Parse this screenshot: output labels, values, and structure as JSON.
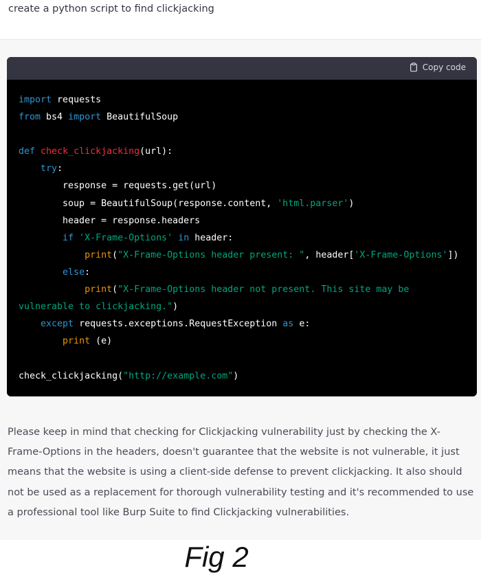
{
  "prompt": {
    "text": "create a python script to find clickjacking"
  },
  "code_block": {
    "copy_label": "Copy code",
    "lines": [
      [
        {
          "t": "kw",
          "v": "import"
        },
        {
          "t": "",
          "v": " requests"
        }
      ],
      [
        {
          "t": "kw",
          "v": "from"
        },
        {
          "t": "",
          "v": " bs4 "
        },
        {
          "t": "kw",
          "v": "import"
        },
        {
          "t": "",
          "v": " BeautifulSoup"
        }
      ],
      [],
      [
        {
          "t": "kw",
          "v": "def"
        },
        {
          "t": "",
          "v": " "
        },
        {
          "t": "fn",
          "v": "check_clickjacking"
        },
        {
          "t": "",
          "v": "(url):"
        }
      ],
      [
        {
          "t": "",
          "v": "    "
        },
        {
          "t": "kw",
          "v": "try"
        },
        {
          "t": "",
          "v": ":"
        }
      ],
      [
        {
          "t": "",
          "v": "        response = requests.get(url)"
        }
      ],
      [
        {
          "t": "",
          "v": "        soup = BeautifulSoup(response.content, "
        },
        {
          "t": "str",
          "v": "'html.parser'"
        },
        {
          "t": "",
          "v": ")"
        }
      ],
      [
        {
          "t": "",
          "v": "        header = response.headers"
        }
      ],
      [
        {
          "t": "",
          "v": "        "
        },
        {
          "t": "kw",
          "v": "if"
        },
        {
          "t": "",
          "v": " "
        },
        {
          "t": "str",
          "v": "'X-Frame-Options'"
        },
        {
          "t": "",
          "v": " "
        },
        {
          "t": "kw",
          "v": "in"
        },
        {
          "t": "",
          "v": " header:"
        }
      ],
      [
        {
          "t": "",
          "v": "            "
        },
        {
          "t": "bi",
          "v": "print"
        },
        {
          "t": "",
          "v": "("
        },
        {
          "t": "str",
          "v": "\"X-Frame-Options header present: \""
        },
        {
          "t": "",
          "v": ", header["
        },
        {
          "t": "str",
          "v": "'X-Frame-Options'"
        },
        {
          "t": "",
          "v": "])"
        }
      ],
      [
        {
          "t": "",
          "v": "        "
        },
        {
          "t": "kw",
          "v": "else"
        },
        {
          "t": "",
          "v": ":"
        }
      ],
      [
        {
          "t": "",
          "v": "            "
        },
        {
          "t": "bi",
          "v": "print"
        },
        {
          "t": "",
          "v": "("
        },
        {
          "t": "str",
          "v": "\"X-Frame-Options header not present. This site may be"
        }
      ],
      [
        {
          "t": "str",
          "v": "vulnerable to clickjacking.\""
        },
        {
          "t": "",
          "v": ")"
        }
      ],
      [
        {
          "t": "",
          "v": "    "
        },
        {
          "t": "kw",
          "v": "except"
        },
        {
          "t": "",
          "v": " requests.exceptions.RequestException "
        },
        {
          "t": "kw",
          "v": "as"
        },
        {
          "t": "",
          "v": " e:"
        }
      ],
      [
        {
          "t": "",
          "v": "        "
        },
        {
          "t": "bi",
          "v": "print"
        },
        {
          "t": "",
          "v": " (e)"
        }
      ],
      [],
      [
        {
          "t": "",
          "v": "check_clickjacking("
        },
        {
          "t": "str",
          "v": "\"http://example.com\""
        },
        {
          "t": "",
          "v": ")"
        }
      ]
    ]
  },
  "response": {
    "text": "Please keep in mind that checking for Clickjacking vulnerability just by checking the X-Frame-Options in the headers, doesn't guarantee that the website is not vulnerable, it just means that the website is using a client-side defense to prevent clickjacking. It also should not be used as a replacement for thorough vulnerability testing and it's recommended to use a professional tool like Burp Suite to find Clickjacking vulnerabilities."
  },
  "caption": {
    "text": "Fig 2"
  },
  "colors": {
    "keyword": "#2e95d3",
    "function": "#f22c3d",
    "string": "#00a67d",
    "builtin": "#e9950c",
    "code_bg": "#000000",
    "code_header_bg": "#343541",
    "response_bg": "#f7f7f8"
  },
  "icons": {
    "copy": "clipboard-icon"
  }
}
